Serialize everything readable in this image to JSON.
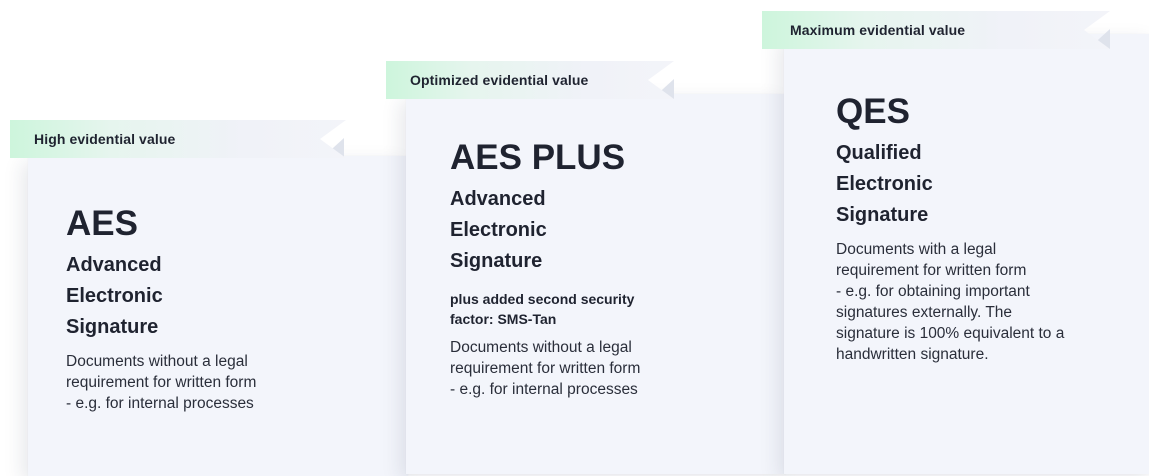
{
  "tiers": [
    {
      "ribbon": "High evidential value",
      "abbreviation": "AES",
      "name_lines": [
        "Advanced",
        "Electronic",
        "Signature"
      ],
      "extra": "",
      "description_lines": [
        "Documents without a legal",
        "requirement for written form",
        "- e.g. for internal processes"
      ]
    },
    {
      "ribbon": "Optimized evidential value",
      "abbreviation": "AES PLUS",
      "name_lines": [
        "Advanced",
        "Electronic",
        "Signature"
      ],
      "extra": "plus added second security factor: SMS-Tan",
      "description_lines": [
        "Documents without a legal",
        "requirement for written form",
        "- e.g. for internal processes"
      ]
    },
    {
      "ribbon": "Maximum evidential value",
      "abbreviation": "QES",
      "name_lines": [
        "Qualified",
        "Electronic",
        "Signature"
      ],
      "extra": "",
      "description_lines": [
        "Documents with a legal",
        "requirement for written form",
        "- e.g. for obtaining important",
        "signatures externally. The",
        "signature is 100% equivalent to a",
        "handwritten signature."
      ]
    }
  ],
  "colors": {
    "card_background": "#f3f5fb",
    "ribbon_accent": "#cdf5dc",
    "text": "#1f2330"
  }
}
